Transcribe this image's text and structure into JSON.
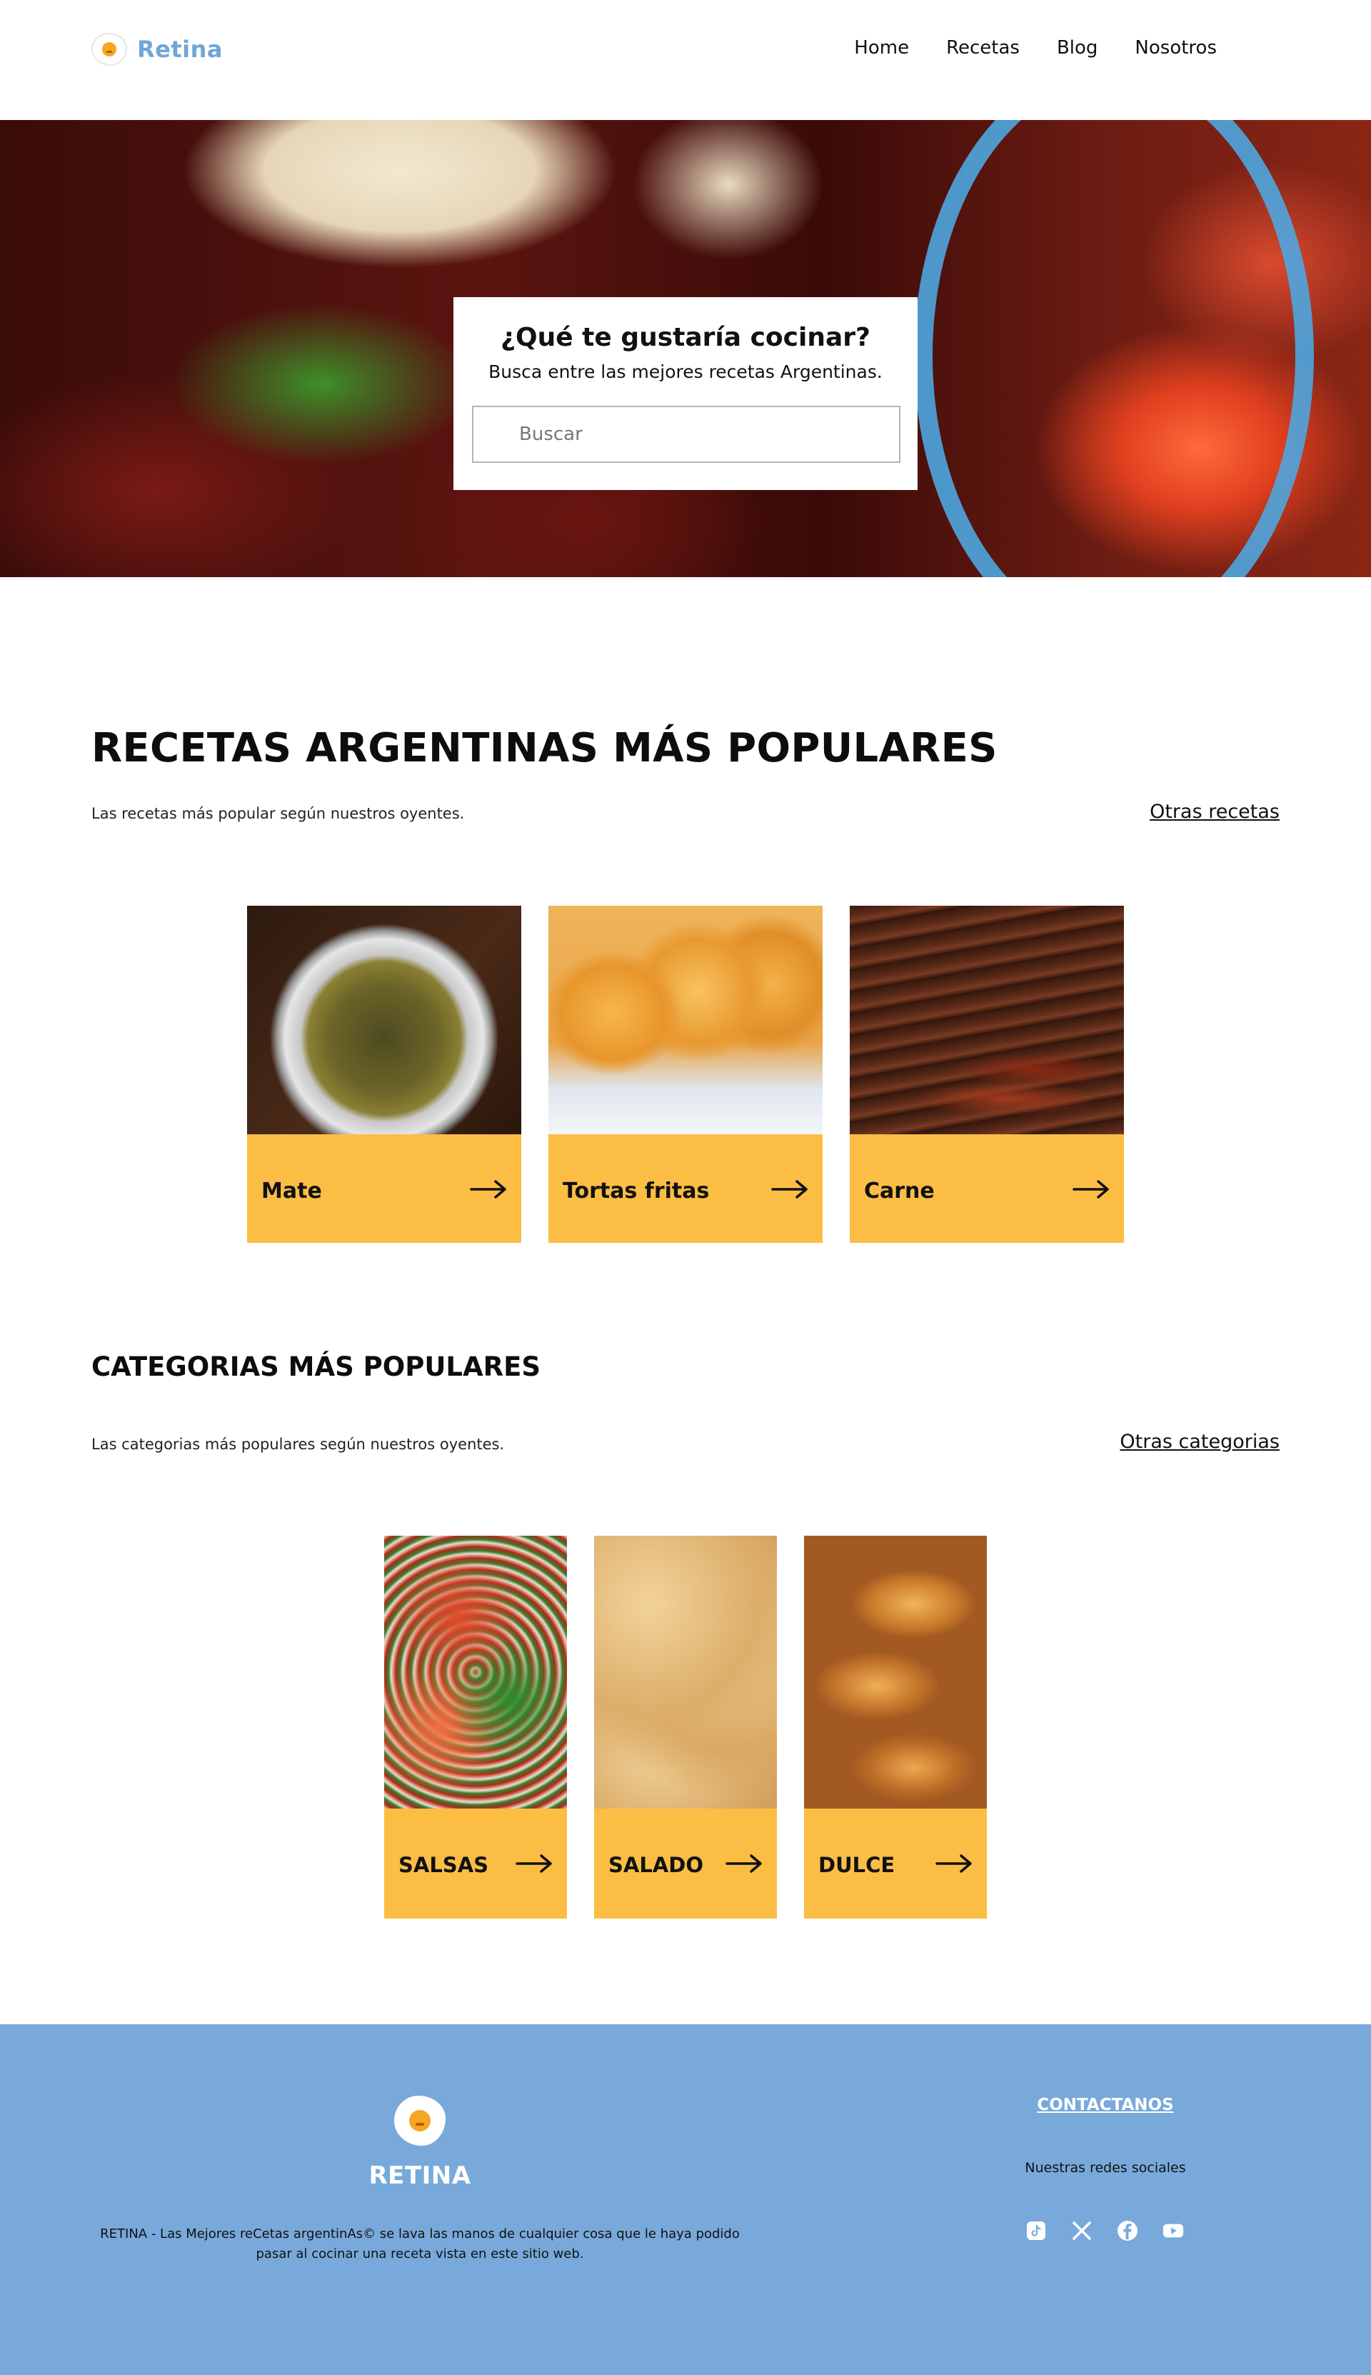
{
  "header": {
    "brand": "Retina",
    "nav": [
      "Home",
      "Recetas",
      "Blog",
      "Nosotros"
    ]
  },
  "hero": {
    "title": "¿Qué te gustaría cocinar?",
    "subtitle": "Busca entre las mejores recetas Argentinas.",
    "search_placeholder": "Buscar"
  },
  "popular_recipes": {
    "title": "RECETAS ARGENTINAS MÁS POPULARES",
    "subtitle": "Las recetas más popular según nuestros oyentes.",
    "link": "Otras recetas",
    "items": [
      {
        "label": "Mate",
        "icon": "arrow-right-icon"
      },
      {
        "label": "Tortas fritas",
        "icon": "arrow-right-icon"
      },
      {
        "label": "Carne",
        "icon": "arrow-right-icon"
      }
    ]
  },
  "popular_categories": {
    "title": "CATEGORIAS MÁS POPULARES",
    "subtitle": "Las categorias más populares según nuestros oyentes.",
    "link": "Otras categorias",
    "items": [
      {
        "label": "SALSAS",
        "icon": "arrow-right-icon"
      },
      {
        "label": "SALADO",
        "icon": "arrow-right-icon"
      },
      {
        "label": "DULCE",
        "icon": "arrow-right-icon"
      }
    ]
  },
  "footer": {
    "brand": "RETINA",
    "disclaimer": "RETINA - Las Mejores reCetas argentinAs© se lava las manos de cualquier cosa que le haya podido pasar al cocinar una receta vista en este sitio web.",
    "contact": "CONTACTANOS",
    "social_label": "Nuestras redes sociales",
    "social_icons": [
      "tiktok-icon",
      "x-icon",
      "facebook-icon",
      "youtube-icon"
    ]
  },
  "colors": {
    "accent_yellow": "#fcbd45",
    "footer_blue": "#78a9da",
    "brand_blue": "#6fa6d6"
  }
}
